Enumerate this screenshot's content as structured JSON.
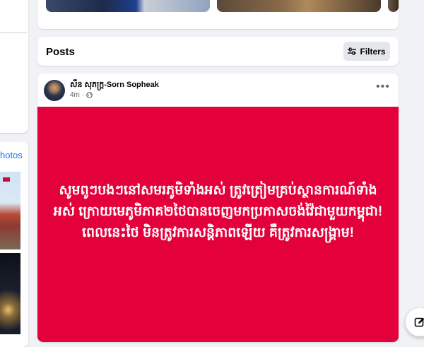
{
  "left": {
    "photos_link": "hotos"
  },
  "posts": {
    "title": "Posts",
    "filters_label": "Filters"
  },
  "post": {
    "author": "សឺន សុភក្រ្ត-Sorn Sopheak",
    "time": "4m",
    "audience_icon": "globe-icon",
    "more_icon": "more-horizontal-icon",
    "more_label": "•••",
    "banner_color": "#e4003b",
    "banner_text": "សូមពូៗបងៗនៅសមរភូមិទាំងអស់ ត្រូវត្រៀមគ្រប់ស្ថានការណ៍ទាំងអស់ ក្រោយមេភូមិភាគ២ថៃបានចេញមកប្រកាសចង់វ៉ៃជាមួយកម្ពុជា! ពេលនេះថៃ មិនត្រូវការសន្តិភាពឡើយ គឺត្រូវការសង្គ្រាម!"
  },
  "compose": {
    "icon": "edit-icon"
  }
}
